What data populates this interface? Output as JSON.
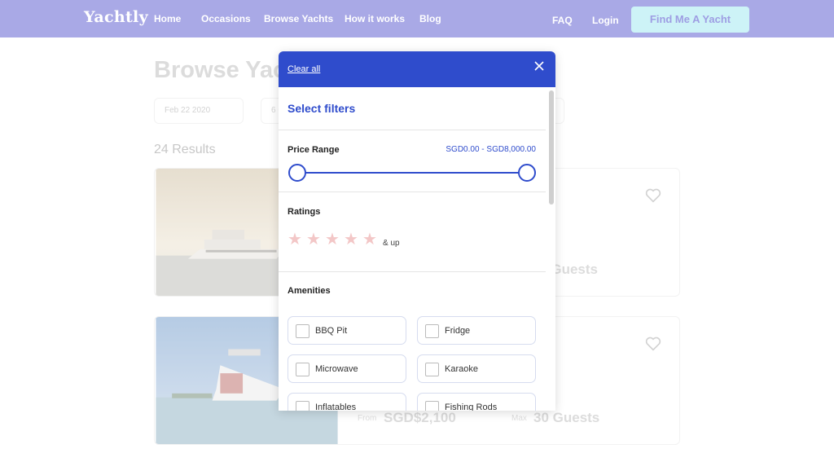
{
  "nav": {
    "logo": "Yachtly",
    "links": [
      "Home",
      "Occasions",
      "Browse Yachts",
      "How it works",
      "Blog"
    ],
    "faq": "FAQ",
    "login": "Login",
    "cta": "Find Me A Yacht"
  },
  "page": {
    "title": "Browse Yac",
    "date_filter": "Feb 22 2020",
    "guest_filter": "6 G",
    "results": "24 Results",
    "cards": [
      {
        "guests": "Guests"
      },
      {
        "from_label": "From",
        "price": "SGD$2,100",
        "max_label": "Max",
        "guests": "30 Guests"
      }
    ]
  },
  "modal": {
    "clear_all": "Clear all",
    "title": "Select filters",
    "price_range": {
      "label": "Price Range",
      "value": "SGD0.00 - SGD8,000.00"
    },
    "ratings": {
      "label": "Ratings",
      "stars": 5,
      "suffix": "& up"
    },
    "amenities": {
      "label": "Amenities",
      "items": [
        "BBQ Pit",
        "Fridge",
        "Microwave",
        "Karaoke",
        "Inflatables",
        "Fishing Rods"
      ]
    }
  },
  "colors": {
    "nav_bg": "#a9a9e6",
    "modal_header": "#2f4ccc",
    "cta_bg": "#cdf3f7",
    "star": "#f3c7c7"
  }
}
